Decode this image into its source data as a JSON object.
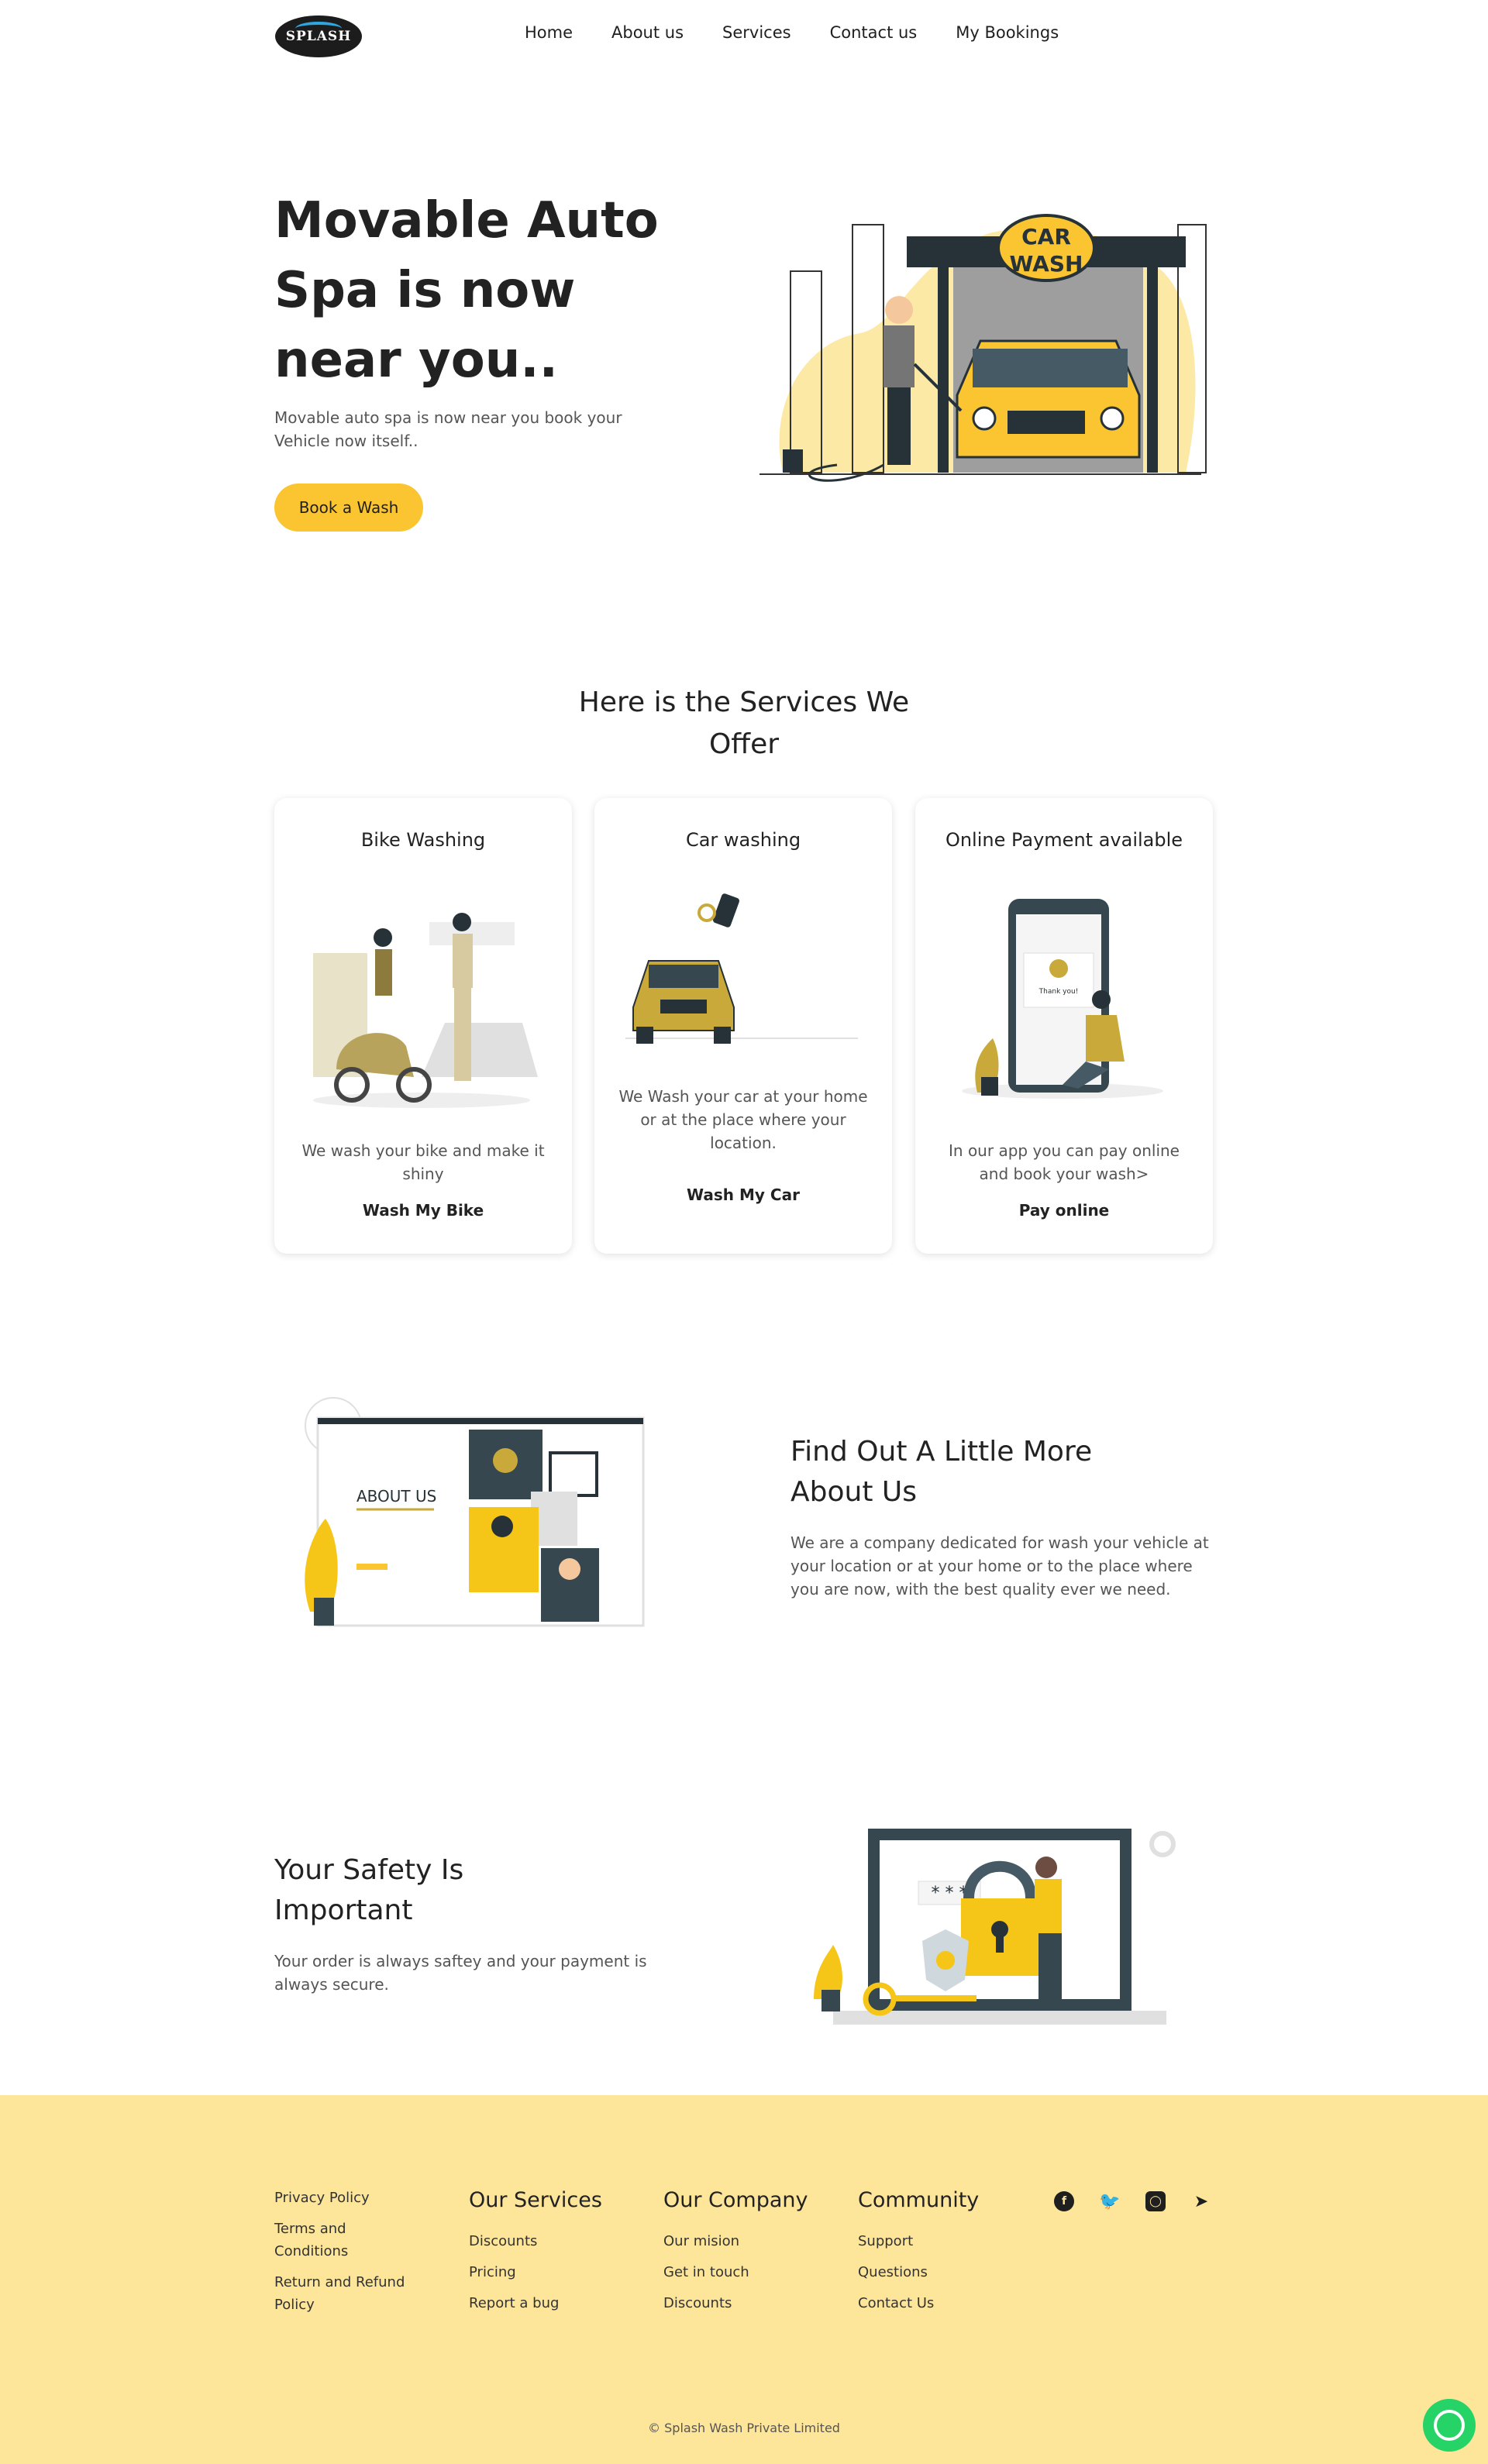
{
  "nav": {
    "logo_text": "SPLASH",
    "links": [
      "Home",
      "About us",
      "Services",
      "Contact us",
      "My Bookings"
    ]
  },
  "hero": {
    "title": "Movable Auto Spa is now near you..",
    "subtitle": "Movable auto spa is now near you book your Vehicle now itself..",
    "button": "Book a Wash",
    "sign_text": "CAR WASH"
  },
  "services": {
    "title": "Here is the Services We Offer",
    "cards": [
      {
        "title": "Bike Washing",
        "desc": "We wash your bike and make it shiny",
        "link": "Wash My Bike"
      },
      {
        "title": "Car washing",
        "desc": "We Wash your car at your home or at the place where your location.",
        "link": "Wash My Car"
      },
      {
        "title": "Online Payment available",
        "desc": "In our app you can pay online and book your wash>",
        "link": "Pay online"
      }
    ]
  },
  "about": {
    "image_label": "ABOUT US",
    "title": "Find Out A Little More About Us",
    "text": "We are a company dedicated for wash your vehicle at your location or at your home or to the place where you are now, with the best quality ever we need."
  },
  "safety": {
    "title": "Your Safety Is Important",
    "text": "Your order is always saftey and your payment is always secure."
  },
  "footer": {
    "col1": [
      "Privacy Policy",
      "Terms and Conditions",
      "Return and Refund Policy"
    ],
    "services": {
      "title": "Our Services",
      "items": [
        "Discounts",
        "Pricing",
        "Report a bug"
      ]
    },
    "company": {
      "title": "Our Company",
      "items": [
        "Our mision",
        "Get in touch",
        "Discounts"
      ]
    },
    "community": {
      "title": "Community",
      "items": [
        "Support",
        "Questions",
        "Contact Us"
      ]
    },
    "socials": [
      "facebook-icon",
      "twitter-icon",
      "instagram-icon",
      "telegram-icon"
    ],
    "copyright": "© Splash Wash Private Limited"
  },
  "colors": {
    "accent": "#fbc531",
    "footer_bg": "#fde59a",
    "whatsapp": "#25d366"
  }
}
